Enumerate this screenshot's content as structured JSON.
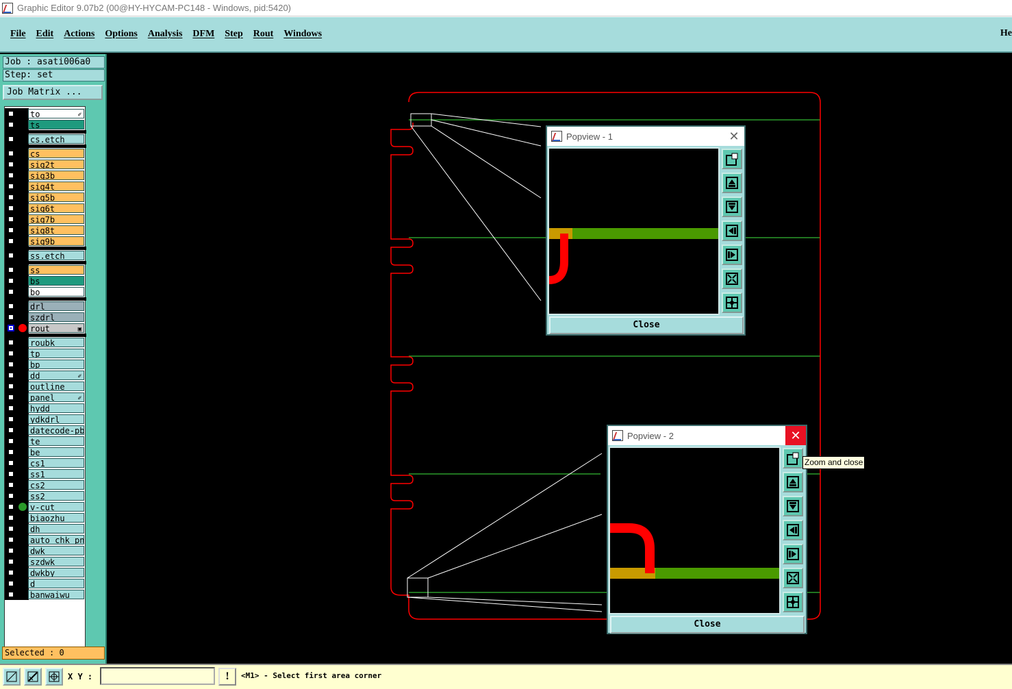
{
  "window": {
    "title": "Graphic Editor 9.07b2 (00@HY-HYCAM-PC148 - Windows, pid:5420)"
  },
  "menu": {
    "items": [
      "File",
      "Edit",
      "Actions",
      "Options",
      "Analysis",
      "DFM",
      "Step",
      "Rout",
      "Windows"
    ],
    "help": "He"
  },
  "job": {
    "label": "Job : asati006a0",
    "step": "Step: set",
    "matrix_button": "Job Matrix ..."
  },
  "layers": [
    {
      "name": "to",
      "color": "#ffffff",
      "flag": "✐"
    },
    {
      "name": "ts",
      "color": "#1e9a7e"
    },
    {
      "name": "cs.etch",
      "color": "#a6dcdc"
    },
    {
      "name": "cs",
      "color": "#ffc060"
    },
    {
      "name": "sig2t",
      "color": "#ffc060"
    },
    {
      "name": "sig3b",
      "color": "#ffc060"
    },
    {
      "name": "sig4t",
      "color": "#ffc060"
    },
    {
      "name": "sig5b",
      "color": "#ffc060"
    },
    {
      "name": "sig6t",
      "color": "#ffc060"
    },
    {
      "name": "sig7b",
      "color": "#ffc060"
    },
    {
      "name": "sig8t",
      "color": "#ffc060"
    },
    {
      "name": "sig9b",
      "color": "#ffc060"
    },
    {
      "name": "ss.etch",
      "color": "#a6dcdc"
    },
    {
      "name": "ss",
      "color": "#ffc060"
    },
    {
      "name": "bs",
      "color": "#1e9a7e"
    },
    {
      "name": "bo",
      "color": "#ffffff"
    },
    {
      "name": "drl",
      "color": "#9ab0b8"
    },
    {
      "name": "szdrl",
      "color": "#9ab0b8"
    },
    {
      "name": "rout",
      "color": "#c8c8c8",
      "dot": "#ff0000",
      "selected": true,
      "flag": "▣"
    },
    {
      "name": "roubk",
      "color": "#a6dcdc"
    },
    {
      "name": "tp",
      "color": "#a6dcdc"
    },
    {
      "name": "bp",
      "color": "#a6dcdc"
    },
    {
      "name": "dd",
      "color": "#a6dcdc",
      "flag": "✐"
    },
    {
      "name": "outline",
      "color": "#a6dcdc"
    },
    {
      "name": "panel",
      "color": "#a6dcdc",
      "flag": "✐"
    },
    {
      "name": "hydd",
      "color": "#a6dcdc"
    },
    {
      "name": "ydkdrl",
      "color": "#a6dcdc"
    },
    {
      "name": "datecode-pbe",
      "color": "#a6dcdc"
    },
    {
      "name": "te",
      "color": "#a6dcdc"
    },
    {
      "name": "be",
      "color": "#a6dcdc"
    },
    {
      "name": "cs1",
      "color": "#a6dcdc"
    },
    {
      "name": "ss1",
      "color": "#a6dcdc"
    },
    {
      "name": "cs2",
      "color": "#a6dcdc"
    },
    {
      "name": "ss2",
      "color": "#a6dcdc"
    },
    {
      "name": "v-cut",
      "color": "#a6dcdc",
      "dot": "#2a9a2a"
    },
    {
      "name": "biaozhu",
      "color": "#a6dcdc"
    },
    {
      "name": "dh",
      "color": "#a6dcdc"
    },
    {
      "name": "auto_chk_pnl",
      "color": "#a6dcdc"
    },
    {
      "name": "dwk",
      "color": "#a6dcdc"
    },
    {
      "name": "szdwk",
      "color": "#a6dcdc"
    },
    {
      "name": "dwkby",
      "color": "#a6dcdc"
    },
    {
      "name": "d",
      "color": "#a6dcdc"
    },
    {
      "name": "banwaiwu",
      "color": "#a6dcdc"
    }
  ],
  "selected": "Selected : 0",
  "status": {
    "xy_label": "X Y :",
    "xy_value": "",
    "warn": "!",
    "prompt": "<M1> - Select first area corner"
  },
  "popups": [
    {
      "title": "Popview - 1",
      "close_label": "Close",
      "close_icon": "close-x-icon"
    },
    {
      "title": "Popview - 2",
      "close_label": "Close",
      "close_icon": "close-x-icon"
    }
  ],
  "tooltip": "Zoom and close",
  "colors": {
    "rout": "#ff0000",
    "vcut": "#2a9a2a",
    "bg": "#000000",
    "panel": "#a6dcdc"
  }
}
